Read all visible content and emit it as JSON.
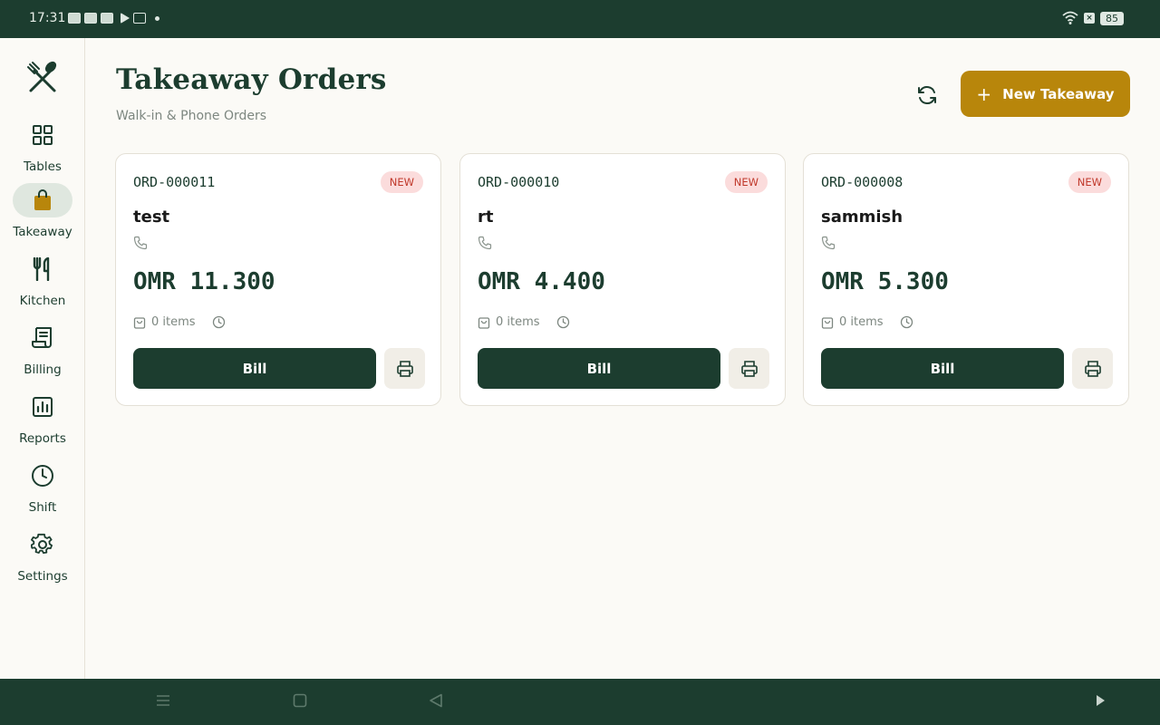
{
  "status_bar": {
    "time": "17:31",
    "battery": "85"
  },
  "sidebar": {
    "items": [
      {
        "label": "Tables",
        "icon": "grid-icon",
        "active": false
      },
      {
        "label": "Takeaway",
        "icon": "shopping-bag-icon",
        "active": true
      },
      {
        "label": "Kitchen",
        "icon": "utensils-icon",
        "active": false
      },
      {
        "label": "Billing",
        "icon": "receipt-icon",
        "active": false
      },
      {
        "label": "Reports",
        "icon": "bar-chart-icon",
        "active": false
      },
      {
        "label": "Shift",
        "icon": "clock-icon",
        "active": false
      },
      {
        "label": "Settings",
        "icon": "gear-icon",
        "active": false
      }
    ]
  },
  "header": {
    "title": "Takeaway Orders",
    "subtitle": "Walk-in & Phone Orders",
    "new_button": "New Takeaway"
  },
  "orders": [
    {
      "id": "ORD-000011",
      "status": "NEW",
      "customer": "test",
      "amount": "OMR 11.300",
      "items": "0 items",
      "bill_label": "Bill"
    },
    {
      "id": "ORD-000010",
      "status": "NEW",
      "customer": "rt",
      "amount": "OMR 4.400",
      "items": "0 items",
      "bill_label": "Bill"
    },
    {
      "id": "ORD-000008",
      "status": "NEW",
      "customer": "sammish",
      "amount": "OMR 5.300",
      "items": "0 items",
      "bill_label": "Bill"
    }
  ],
  "colors": {
    "primary": "#1c3d2f",
    "accent": "#b8860b",
    "badge_bg": "#fbdcdc",
    "badge_text": "#c0392b",
    "background": "#fbfaf6"
  }
}
